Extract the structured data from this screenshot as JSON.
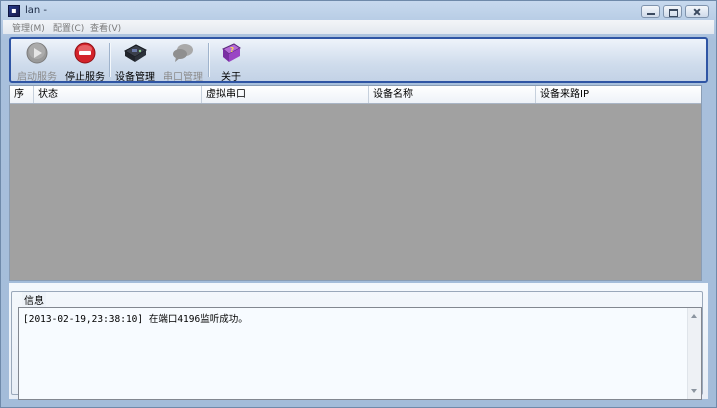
{
  "window": {
    "title": "lan -"
  },
  "menu": [
    "管理(M)",
    "配置(C)",
    "查看(V)"
  ],
  "toolbar": {
    "start_service": "启动服务",
    "stop_service": "停止服务",
    "device_manage": "设备管理",
    "port_manage": "串口管理",
    "about": "关于"
  },
  "grid": {
    "columns": [
      "序",
      "状态",
      "虚拟串口",
      "设备名称",
      "设备来路IP"
    ],
    "rows": []
  },
  "info": {
    "legend": "信息",
    "log": [
      "[2013-02-19,23:38:10] 在端口4196监听成功。"
    ]
  },
  "icons": {
    "start_service": "play-icon",
    "stop_service": "stop-icon",
    "device_manage": "device-icon",
    "port_manage": "chat-bubble-icon",
    "about": "book-help-icon"
  },
  "colors": {
    "toolbar_border": "#2f55a4",
    "grid_bg": "#a1a1a1"
  }
}
